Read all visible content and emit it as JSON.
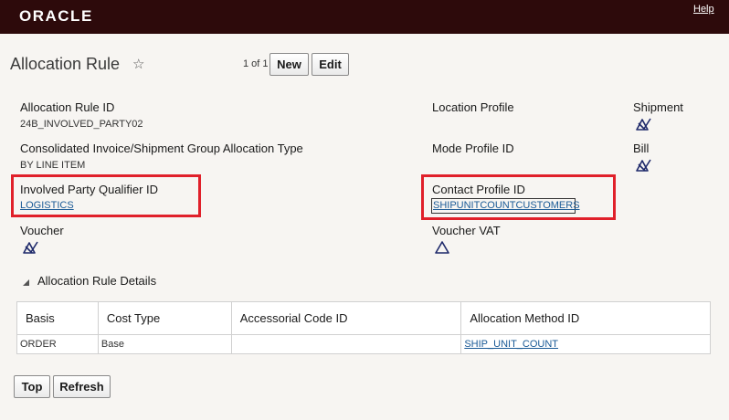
{
  "header": {
    "logo": "ORACLE",
    "help": "Help"
  },
  "page": {
    "title": "Allocation Rule",
    "star": "☆",
    "pager": "1 of 1",
    "new_label": "New",
    "edit_label": "Edit"
  },
  "fields": {
    "allocation_rule_id": {
      "label": "Allocation Rule ID",
      "value": "24B_INVOLVED_PARTY02"
    },
    "location_profile": {
      "label": "Location Profile"
    },
    "shipment": {
      "label": "Shipment",
      "icon": "unchecked-icon"
    },
    "consolidated": {
      "label": "Consolidated Invoice/Shipment Group Allocation Type",
      "value": "BY LINE ITEM"
    },
    "mode_profile": {
      "label": "Mode Profile ID"
    },
    "bill": {
      "label": "Bill",
      "icon": "unchecked-icon"
    },
    "involved_party": {
      "label": "Involved Party Qualifier ID",
      "value": "LOGISTICS"
    },
    "contact_profile": {
      "label": "Contact Profile ID",
      "value": "SHIPUNITCOUNTCUSTOMERS"
    },
    "voucher": {
      "label": "Voucher",
      "icon": "unchecked-icon"
    },
    "voucher_vat": {
      "label": "Voucher VAT",
      "icon": "warning-triangle-icon"
    }
  },
  "details": {
    "title": "Allocation Rule Details",
    "columns": [
      "Basis",
      "Cost Type",
      "Accessorial Code ID",
      "Allocation Method ID"
    ],
    "rows": [
      {
        "basis": "ORDER",
        "cost_type": "Base",
        "accessorial": "",
        "method": "SHIP_UNIT_COUNT"
      }
    ]
  },
  "footer": {
    "top_label": "Top",
    "refresh_label": "Refresh"
  },
  "colors": {
    "header_bg": "#2d0a0b",
    "highlight": "#e0202a",
    "link": "#1a5a96",
    "icon": "#1f2a6b"
  }
}
